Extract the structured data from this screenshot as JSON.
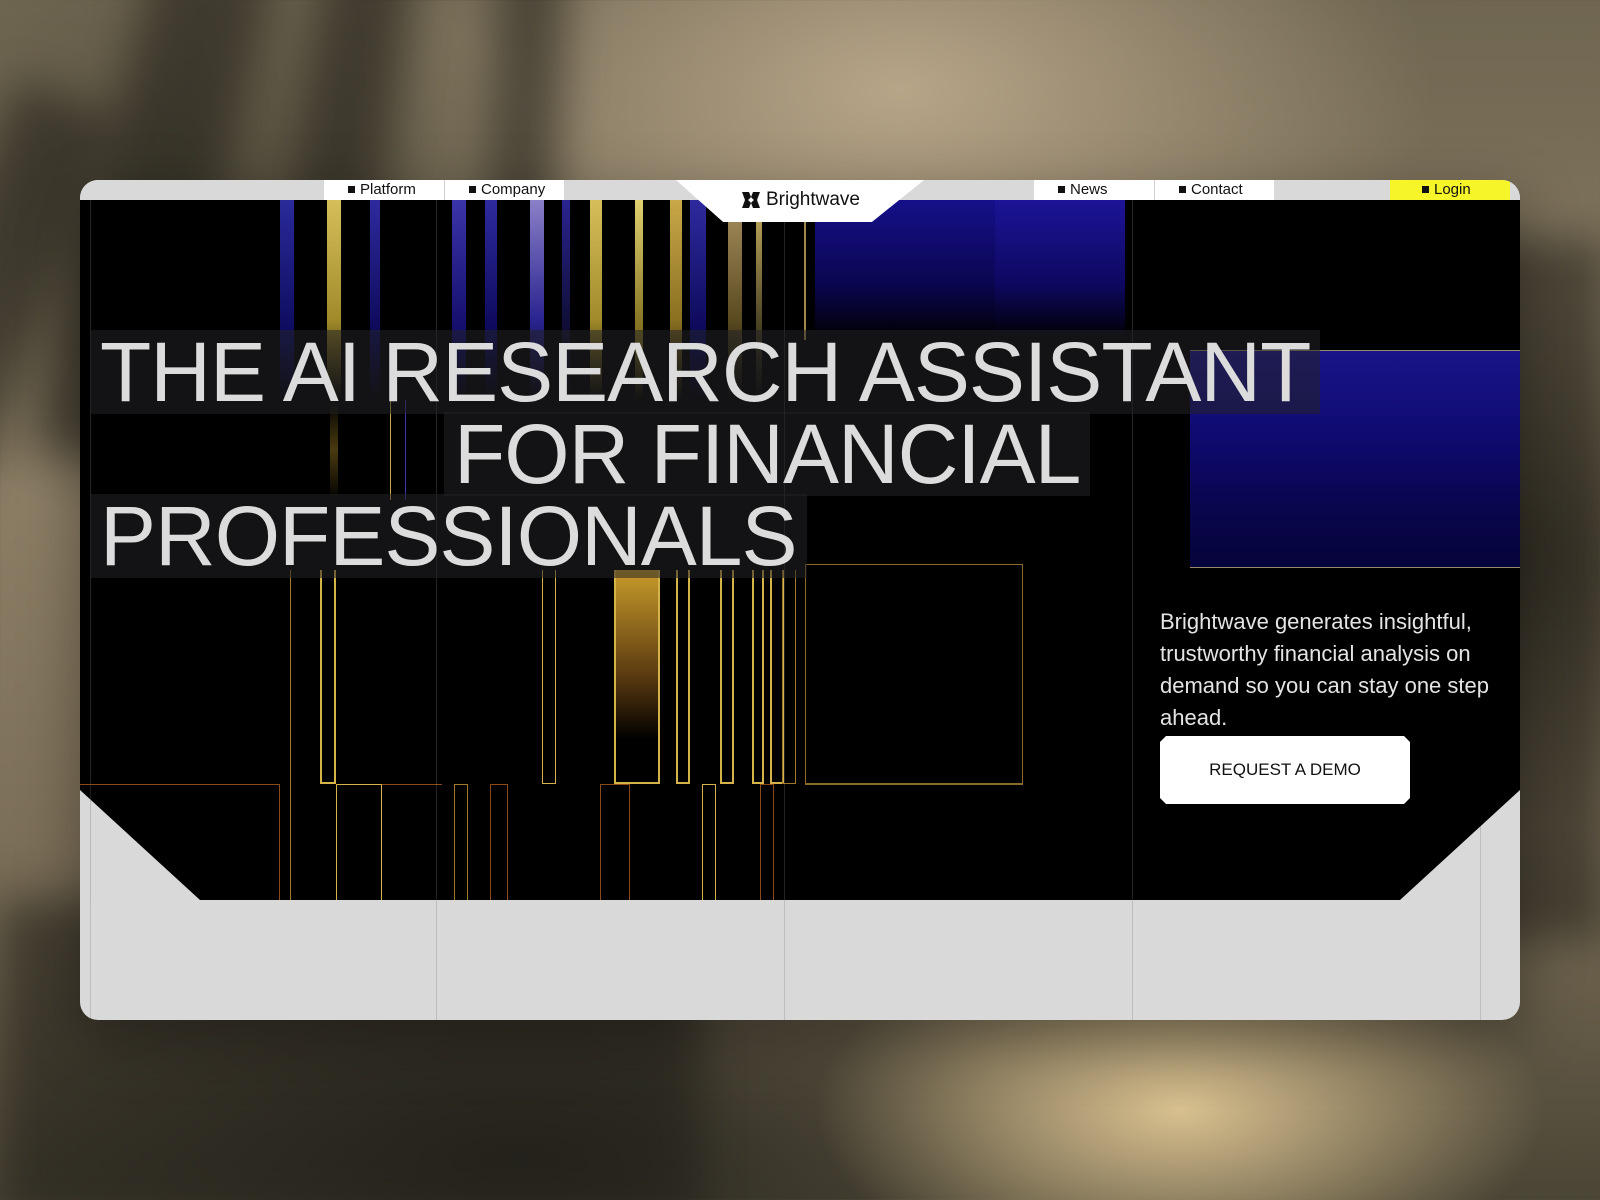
{
  "nav": {
    "left_items": [
      {
        "label": "Platform"
      },
      {
        "label": "Company"
      }
    ],
    "right_items": [
      {
        "label": "News"
      },
      {
        "label": "Contact"
      }
    ],
    "login": {
      "label": "Login",
      "color": "#f5f52a"
    },
    "logo_text": "Brightwave"
  },
  "hero": {
    "headline_lines": [
      "THE AI RESEARCH ASSISTANT",
      "FOR FINANCIAL",
      "PROFESSIONALS"
    ],
    "description": "Brightwave generates insightful, trustworthy financial analysis on demand so you can stay one step ahead.",
    "cta_label": "REQUEST A DEMO"
  },
  "colors": {
    "hero_background": "#000000",
    "accent_gold": "#d6b24a",
    "accent_blue": "#1a148a",
    "panel_gray": "#d9d9d9"
  }
}
